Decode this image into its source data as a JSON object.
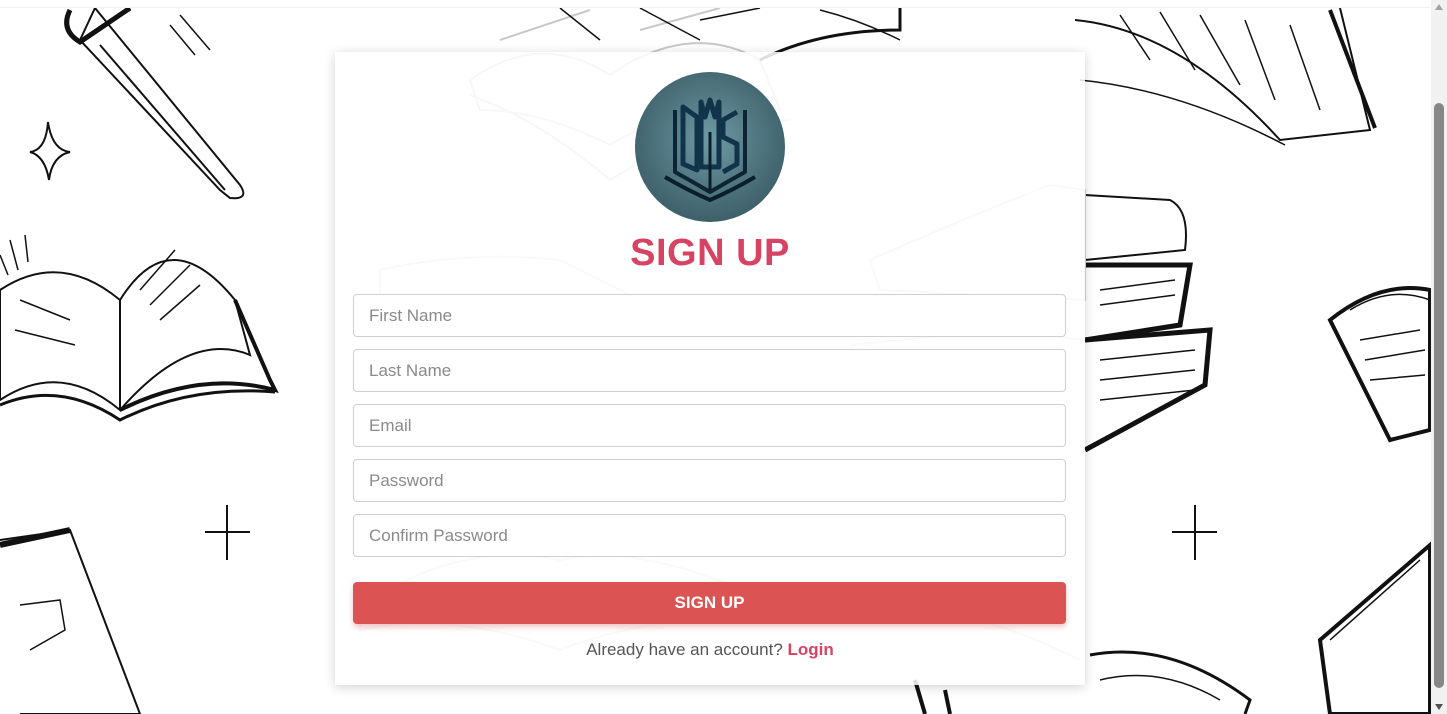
{
  "form": {
    "title": "SIGN UP",
    "fields": {
      "first_name": {
        "placeholder": "First Name",
        "value": ""
      },
      "last_name": {
        "placeholder": "Last Name",
        "value": ""
      },
      "email": {
        "placeholder": "Email",
        "value": ""
      },
      "password": {
        "placeholder": "Password",
        "value": ""
      },
      "confirm_password": {
        "placeholder": "Confirm Password",
        "value": ""
      }
    },
    "submit_label": "SIGN UP",
    "login_prompt": "Already have an account?",
    "login_link": "Login"
  },
  "colors": {
    "accent": "#d64363",
    "button": "#db5352",
    "logo_base": "#4f7680"
  },
  "icons": {
    "logo": "dms-book-logo",
    "background": "book-doodle-pattern"
  }
}
